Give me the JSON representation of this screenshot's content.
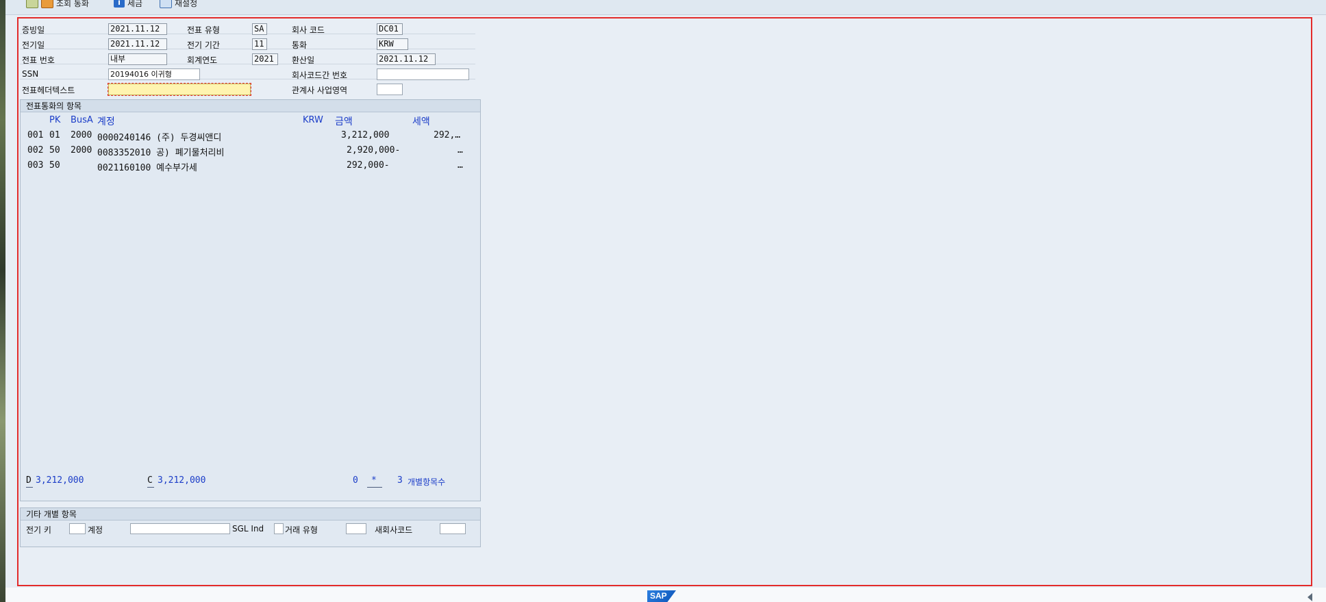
{
  "toolbar": {
    "query_currency": "조회 통화",
    "tax": "세금",
    "reset": "재설정"
  },
  "header": {
    "doc_date_label": "증빙일",
    "doc_date": "2021.11.12",
    "doc_type_label": "전표 유형",
    "doc_type": "SA",
    "company_code_label": "회사 코드",
    "company_code": "DC01",
    "posting_date_label": "전기일",
    "posting_date": "2021.11.12",
    "period_label": "전기 기간",
    "period": "11",
    "currency_label": "통화",
    "currency": "KRW",
    "doc_number_label": "전표 번호",
    "doc_number": "내부",
    "fiscal_year_label": "회계연도",
    "fiscal_year": "2021",
    "translation_date_label": "환산일",
    "translation_date": "2021.11.12",
    "ssn_label": "SSN",
    "ssn": "20194016 이귀형",
    "intercompany_label": "회사코드간 번호",
    "intercompany": "",
    "header_text_label": "전표헤더텍스트",
    "header_text": "",
    "partner_ba_label": "관계사 사업영역",
    "partner_ba": ""
  },
  "items_group": {
    "title": "전표통화의 항목",
    "columns": {
      "pk": "PK",
      "busa": "BusA",
      "account": "계정",
      "krw": "KRW",
      "amount": "금액",
      "tax": "세액"
    },
    "rows": [
      {
        "no": "001",
        "pk": "01",
        "busa": "2000",
        "account": "0000240146 (주) 두경씨앤디",
        "amount": "3,212,000",
        "tax": "292,…"
      },
      {
        "no": "002",
        "pk": "50",
        "busa": "2000",
        "account": "0083352010 공) 폐기물처리비",
        "amount": "2,920,000-",
        "tax": "…"
      },
      {
        "no": "003",
        "pk": "50",
        "busa": "",
        "account": "0021160100 예수부가세",
        "amount": "292,000-",
        "tax": "…"
      }
    ],
    "footer": {
      "debit_label": "D",
      "debit": "3,212,000",
      "credit_label": "C",
      "credit": "3,212,000",
      "balance": "0",
      "status": "*",
      "count": "3",
      "count_label": "개별항목수"
    }
  },
  "other_group": {
    "title": "기타 개별 항목",
    "posting_key_label": "전기 키",
    "posting_key": "",
    "account_label": "계정",
    "account": "",
    "sgl_label": "SGL Ind",
    "sgl": "",
    "trans_type_label": "거래 유형",
    "trans_type": "",
    "new_company_label": "새회사코드",
    "new_company": ""
  },
  "footer": {
    "logo": "SAP"
  },
  "colors": {
    "frame": "#e32a2a",
    "link_blue": "#1a3cc8",
    "background": "#e8eef5",
    "yellow_field": "#fff4b0"
  }
}
